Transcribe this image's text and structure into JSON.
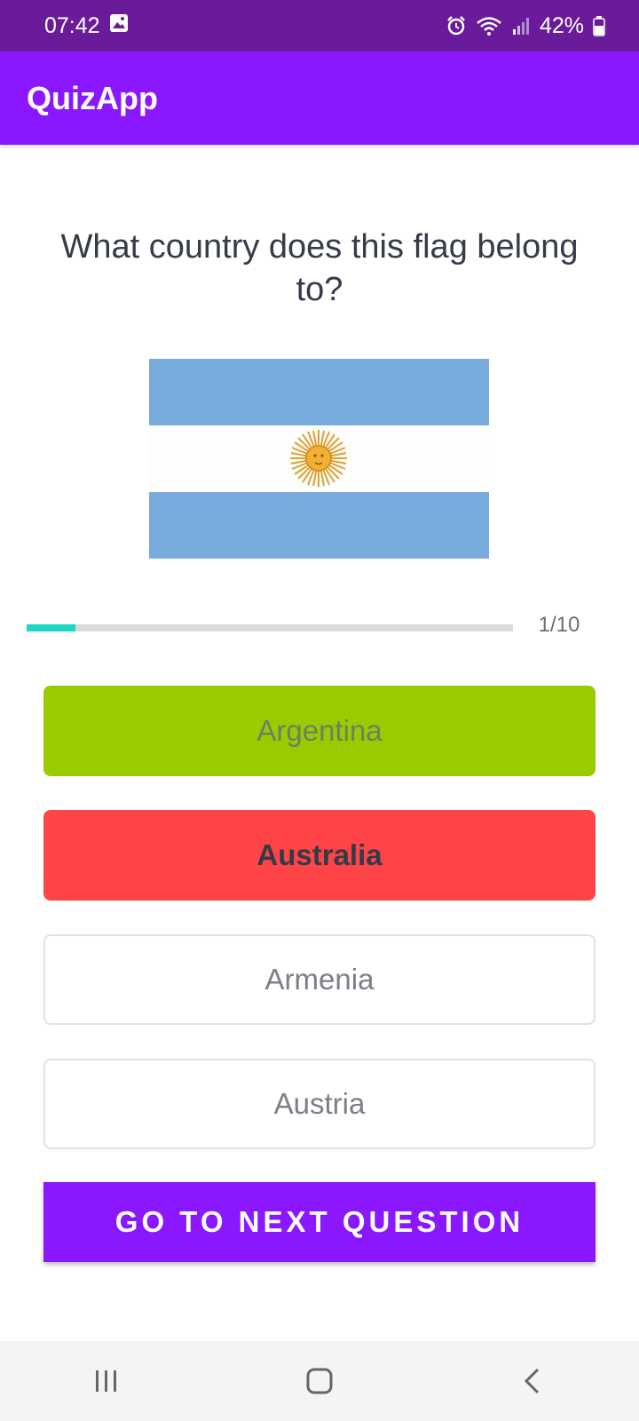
{
  "status_bar": {
    "time": "07:42",
    "battery": "42%",
    "icons": [
      "gallery-icon",
      "alarm-icon",
      "wifi-icon",
      "signal-icon",
      "battery-icon"
    ]
  },
  "app_bar": {
    "title": "QuizApp"
  },
  "question": {
    "text": "What country does this flag belong to?"
  },
  "flag": {
    "icon": "argentina-flag",
    "colors": {
      "stripe": "#78abdc",
      "middle": "#fdfdfb",
      "sun": "#f2b035"
    }
  },
  "progress": {
    "current": 1,
    "total": 10,
    "label": "1/10",
    "fill_color": "#1ed6c4"
  },
  "options": [
    {
      "label": "Argentina",
      "state": "correct",
      "color": "#99cc00"
    },
    {
      "label": "Australia",
      "state": "wrong",
      "color": "#ff4447"
    },
    {
      "label": "Armenia",
      "state": "default"
    },
    {
      "label": "Austria",
      "state": "default"
    }
  ],
  "next_button": {
    "label": "GO TO NEXT QUESTION",
    "color": "#8b17ff"
  },
  "nav_bar": {
    "icons": [
      "recent-apps-icon",
      "home-icon",
      "back-icon"
    ]
  }
}
